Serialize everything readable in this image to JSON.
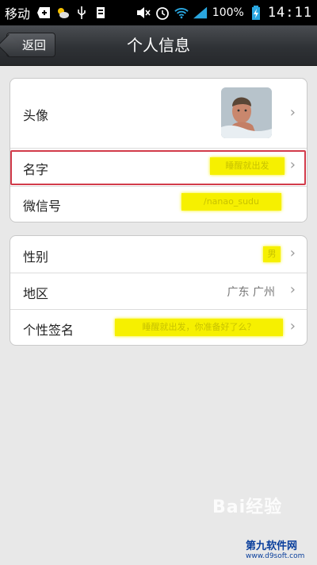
{
  "status_bar": {
    "carrier": "移动",
    "battery": "100%",
    "time": "14:11"
  },
  "header": {
    "back_label": "返回",
    "title": "个人信息"
  },
  "groups": [
    {
      "rows": [
        {
          "label": "头像"
        },
        {
          "label": "名字",
          "value": "睡醒就出发"
        },
        {
          "label": "微信号",
          "value": "/nanao_sudu"
        }
      ]
    },
    {
      "rows": [
        {
          "label": "性别",
          "value": "男"
        },
        {
          "label": "地区",
          "value": "广东 广州"
        },
        {
          "label": "个性签名",
          "value": "睡醒就出发，你准备好了么？"
        }
      ]
    }
  ],
  "watermarks": {
    "baidu": "Bai经验",
    "site_name": "第九软件网",
    "site_url": "www.d9soft.com"
  },
  "colors": {
    "highlight_border": "#d23b4a",
    "redaction": "#f6f000"
  }
}
